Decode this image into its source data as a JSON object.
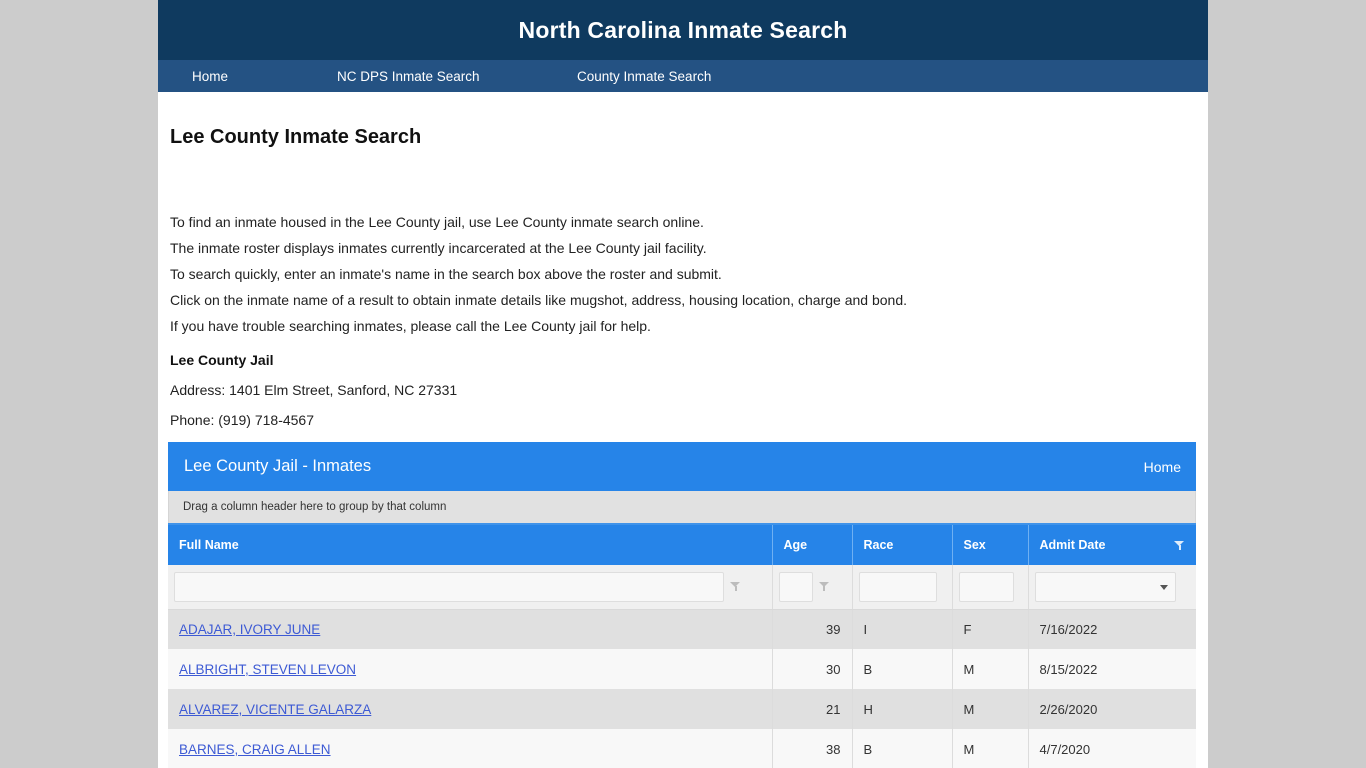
{
  "site": {
    "title": "North Carolina Inmate Search",
    "header_bg": "#0f3a5f",
    "nav_bg": "#245283",
    "accent": "#2684e8",
    "nav": [
      {
        "label": "Home"
      },
      {
        "label": "NC DPS Inmate Search"
      },
      {
        "label": "County Inmate Search"
      }
    ]
  },
  "page": {
    "title": "Lee County Inmate Search",
    "intro": [
      "To find an inmate housed in the Lee County jail, use Lee County inmate search online.",
      "The inmate roster displays inmates currently incarcerated at the Lee County jail facility.",
      "To search quickly, enter an inmate's name in the search box above the roster and submit.",
      "Click on the inmate name of a result to obtain inmate details like mugshot, address, housing location, charge and bond.",
      "If you have trouble searching inmates, please call the Lee County jail for help."
    ],
    "facility": {
      "name": "Lee County Jail",
      "address": "Address: 1401 Elm Street, Sanford, NC 27331",
      "phone": "Phone: (919) 718-4567"
    }
  },
  "grid": {
    "title": "Lee County Jail - Inmates",
    "home_link": "Home",
    "group_panel_text": "Drag a column header here to group by that column",
    "columns": [
      {
        "key": "name",
        "label": "Full Name"
      },
      {
        "key": "age",
        "label": "Age"
      },
      {
        "key": "race",
        "label": "Race"
      },
      {
        "key": "sex",
        "label": "Sex"
      },
      {
        "key": "admit",
        "label": "Admit Date"
      }
    ],
    "header_filter_icon": "filter-funnel-icon",
    "filters": {
      "name_value": "",
      "age_value": "",
      "race_value": "",
      "sex_value": "",
      "admit_value": "",
      "name_placeholder": "",
      "age_placeholder": "",
      "race_placeholder": "",
      "sex_placeholder": "",
      "admit_placeholder": ""
    },
    "rows": [
      {
        "name": "ADAJAR, IVORY JUNE",
        "age": "39",
        "race": "I",
        "sex": "F",
        "admit": "7/16/2022"
      },
      {
        "name": "ALBRIGHT, STEVEN LEVON",
        "age": "30",
        "race": "B",
        "sex": "M",
        "admit": "8/15/2022"
      },
      {
        "name": "ALVAREZ, VICENTE GALARZA",
        "age": "21",
        "race": "H",
        "sex": "M",
        "admit": "2/26/2020"
      },
      {
        "name": "BARNES, CRAIG ALLEN",
        "age": "38",
        "race": "B",
        "sex": "M",
        "admit": "4/7/2020"
      }
    ]
  }
}
